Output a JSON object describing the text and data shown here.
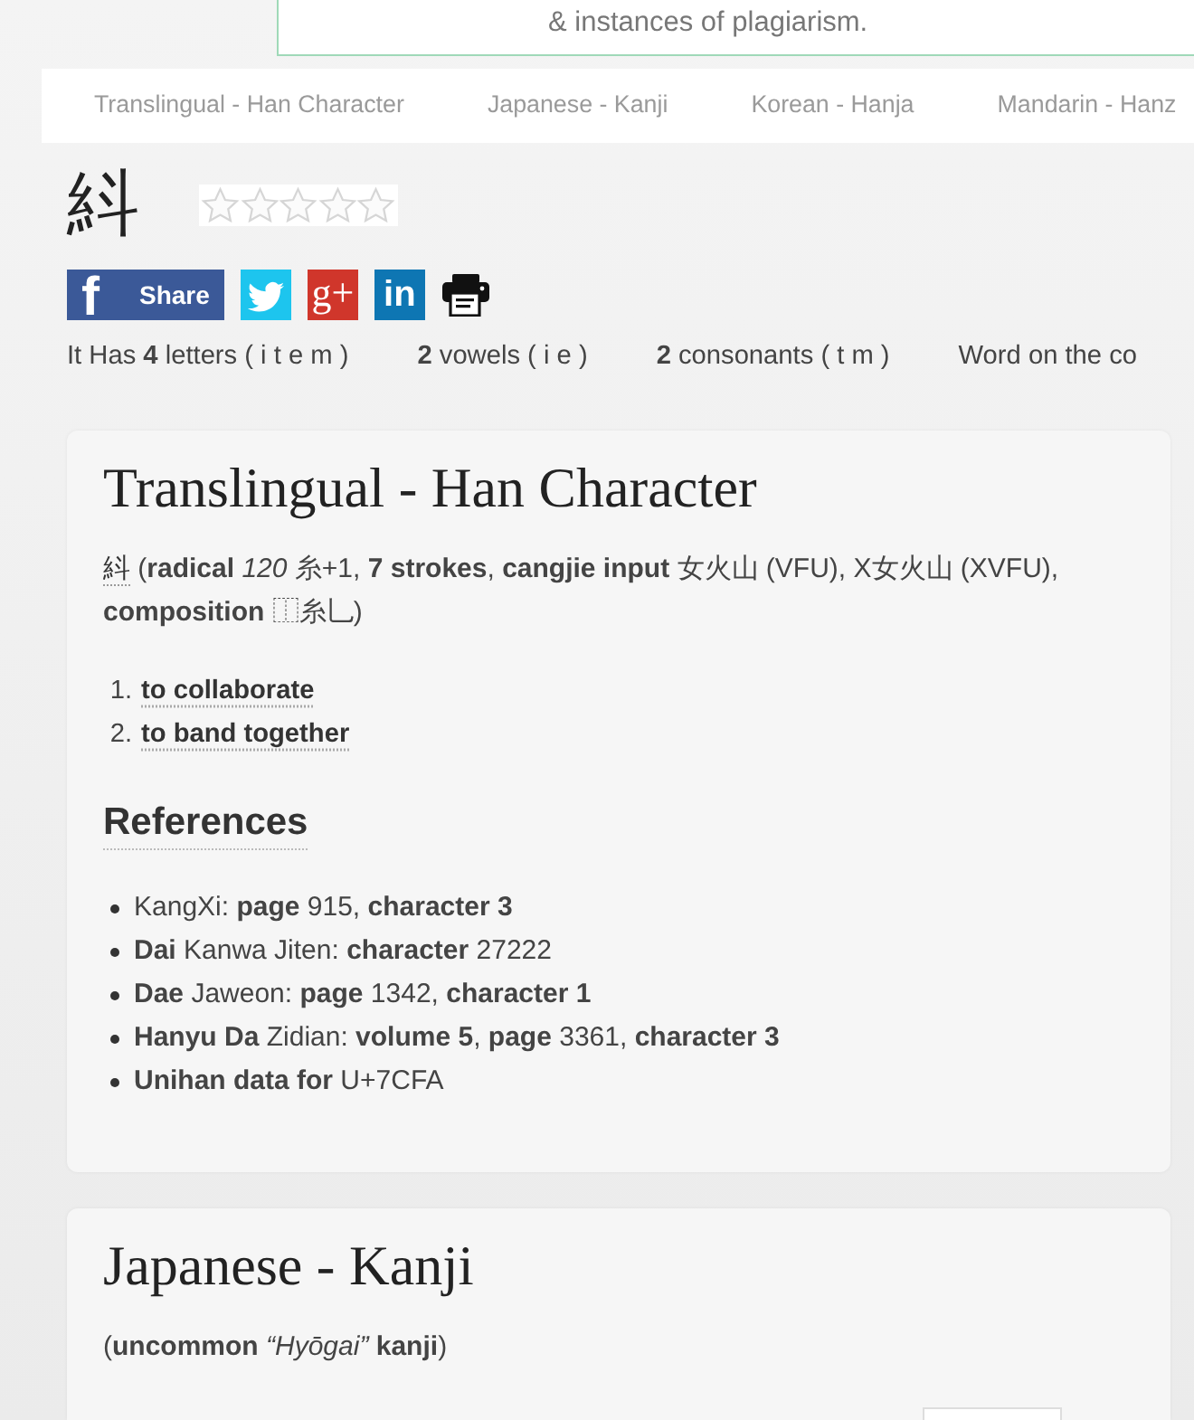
{
  "notice": {
    "text": "& instances of plagiarism."
  },
  "tabs": [
    {
      "label": "Translingual - Han Character",
      "selected": false
    },
    {
      "label": "Japanese - Kanji",
      "selected": false
    },
    {
      "label": "Korean - Hanja",
      "selected": false
    },
    {
      "label": "Mandarin - Hanz",
      "selected": false
    }
  ],
  "character": "紏",
  "rating": {
    "stars": 0
  },
  "share_buttons": [
    {
      "kind": "logo",
      "logo": "f",
      "label": "Share",
      "color": "#3b5998"
    },
    {
      "kind": "bird",
      "color": "#1dc5ee"
    },
    {
      "kind": "logo",
      "logo": "g+",
      "color": "#d0362b"
    },
    {
      "kind": "logo",
      "logo": "in",
      "color": "#0e76b3"
    },
    {
      "kind": "printer"
    }
  ],
  "stats": [
    "It Has **4** letters ( i t e m )",
    "**2** vowels ( i e )",
    "**2** consonants ( t m )",
    "Word on the co"
  ],
  "sections": [
    {
      "title": "Translingual - Han Character",
      "definition": {
        "character": "紏",
        "text": "(**radical** *120* 糸+1, **7 strokes**, **cangjie input** 女火山 (VFU), X女火山 (XVFU), **composition** ⿰糸乚)"
      },
      "senses": [
        {
          "number": "1.",
          "text": "to collaborate"
        },
        {
          "number": "2.",
          "text": "to band together"
        }
      ],
      "references": {
        "title": "References",
        "items": [
          "KangXi: **page** 915, **character 3**",
          "**Dai** Kanwa Jiten: **character** 27222",
          "**Dae** Jaweon: **page** 1342, **character 1**",
          "**Hanyu Da** Zidian: **volume 5**, **page** 3361, **character 3**",
          "**Unihan data for** U+7CFA"
        ]
      }
    },
    {
      "title": "Japanese - Kanji",
      "note": "(**uncommon** *“Hyōgai”* **kanji**)"
    }
  ]
}
